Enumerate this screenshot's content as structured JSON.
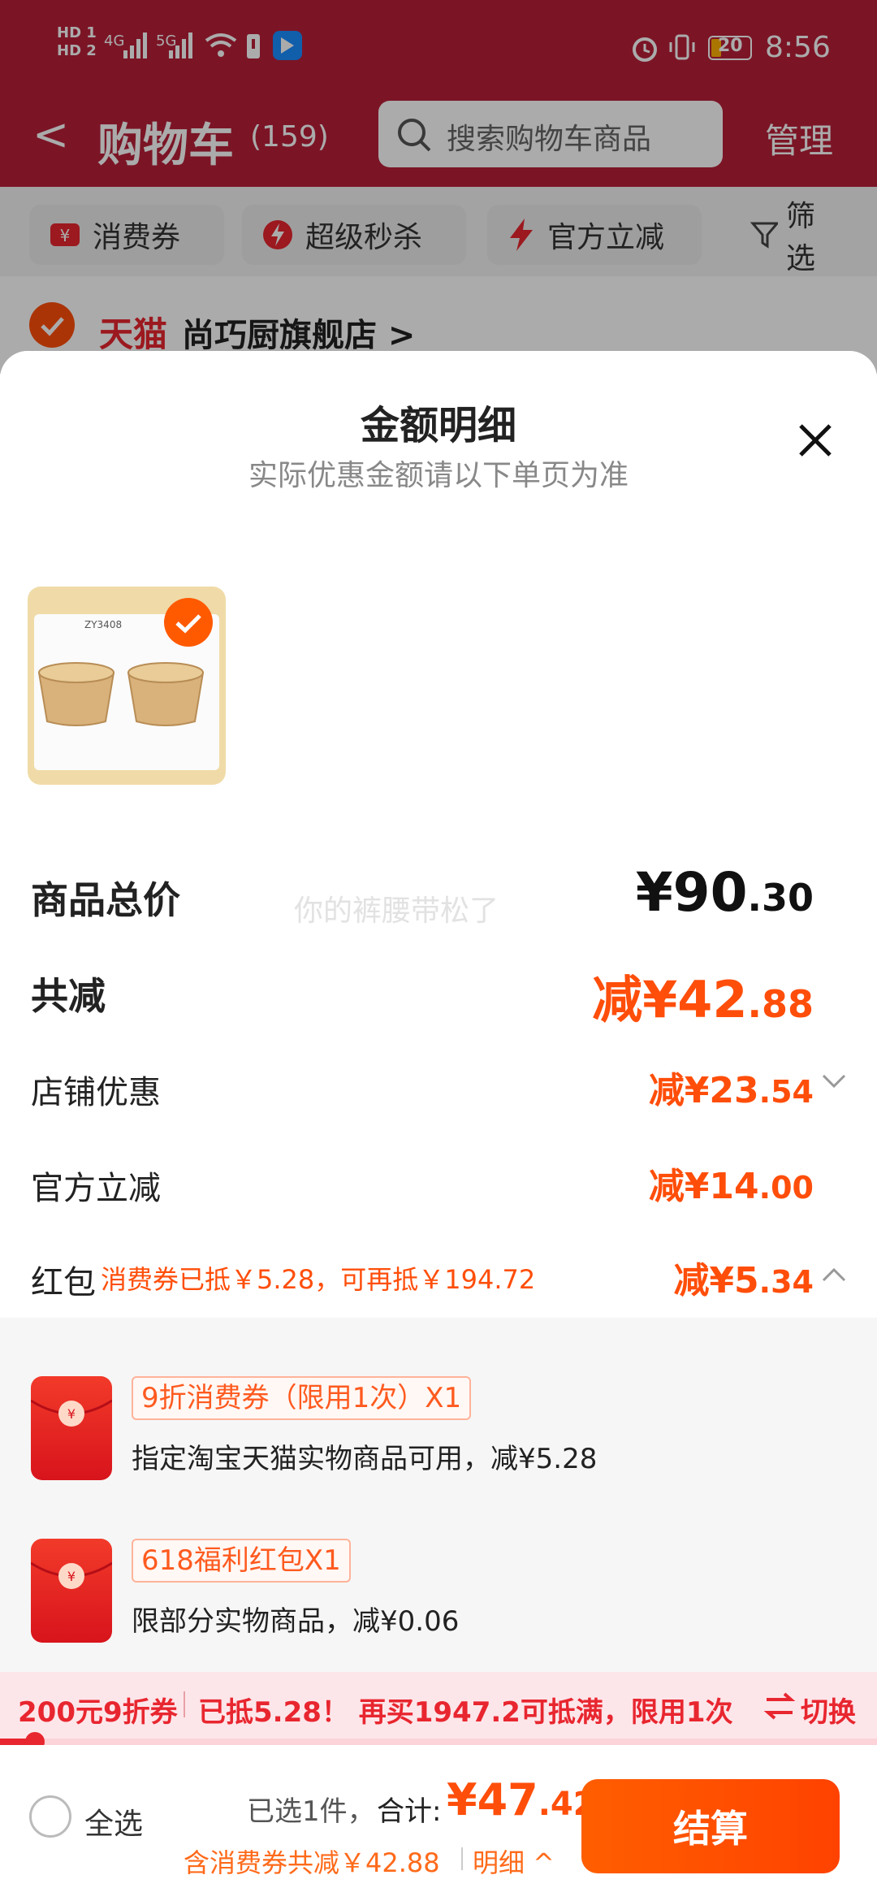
{
  "status_bar": {
    "time": "8:56",
    "battery": "20",
    "net_left": "HD 1 HD 2",
    "signal1": "4G",
    "signal2": "5G"
  },
  "header": {
    "back_label": "<",
    "title": "购物车",
    "count": "(159)",
    "search_placeholder": "搜索购物车商品",
    "manage": "管理"
  },
  "filters": {
    "coupon": "消费券",
    "flash_sale": "超级秒杀",
    "official_discount": "官方立减",
    "filter": "筛选"
  },
  "shop": {
    "platform": "天猫",
    "name": "尚巧厨旗舰店 >"
  },
  "sheet": {
    "title": "金额明细",
    "subtitle": "实际优惠金额请以下单页为准",
    "product_image_caption": "ZY3408",
    "rows": {
      "total_label": "商品总价",
      "total_yuan": "¥90",
      "total_cents": ".30",
      "watermark": "你的裤腰带松了",
      "discount_label": "共减",
      "discount_yuan": "减¥42",
      "discount_cents": ".88",
      "shop_label": "店铺优惠",
      "shop_yuan": "减¥23",
      "shop_cents": ".54",
      "official_label": "官方立减",
      "official_yuan": "减¥14",
      "official_cents": ".00",
      "hongbao_label": "红包",
      "hongbao_note": "消费券已抵￥5.28，可再抵￥194.72",
      "hongbao_yuan": "减¥5",
      "hongbao_cents": ".34"
    },
    "coupons": [
      {
        "tag": "9折消费券（限用1次）X1",
        "desc": "指定淘宝天猫实物商品可用，减¥5.28"
      },
      {
        "tag": "618福利红包X1",
        "desc": "限部分实物商品，减¥0.06"
      }
    ]
  },
  "promo": {
    "left": "200元9折券",
    "middle": "已抵5.28！ 再买1947.2可抵满，限用1次",
    "switch": "切换",
    "progress": 0.04
  },
  "bottom": {
    "select_all": "全选",
    "selected": "已选1件，",
    "total_label": "合计:",
    "total_yuan": "¥47",
    "total_cents": ".42",
    "sub": "含消费券共减￥42.88",
    "detail": "明细 ^",
    "checkout": "结算"
  },
  "colors": {
    "accent": "#ff4e0a",
    "header_bg": "#b8203a",
    "promo_bg": "#fde6ea"
  }
}
